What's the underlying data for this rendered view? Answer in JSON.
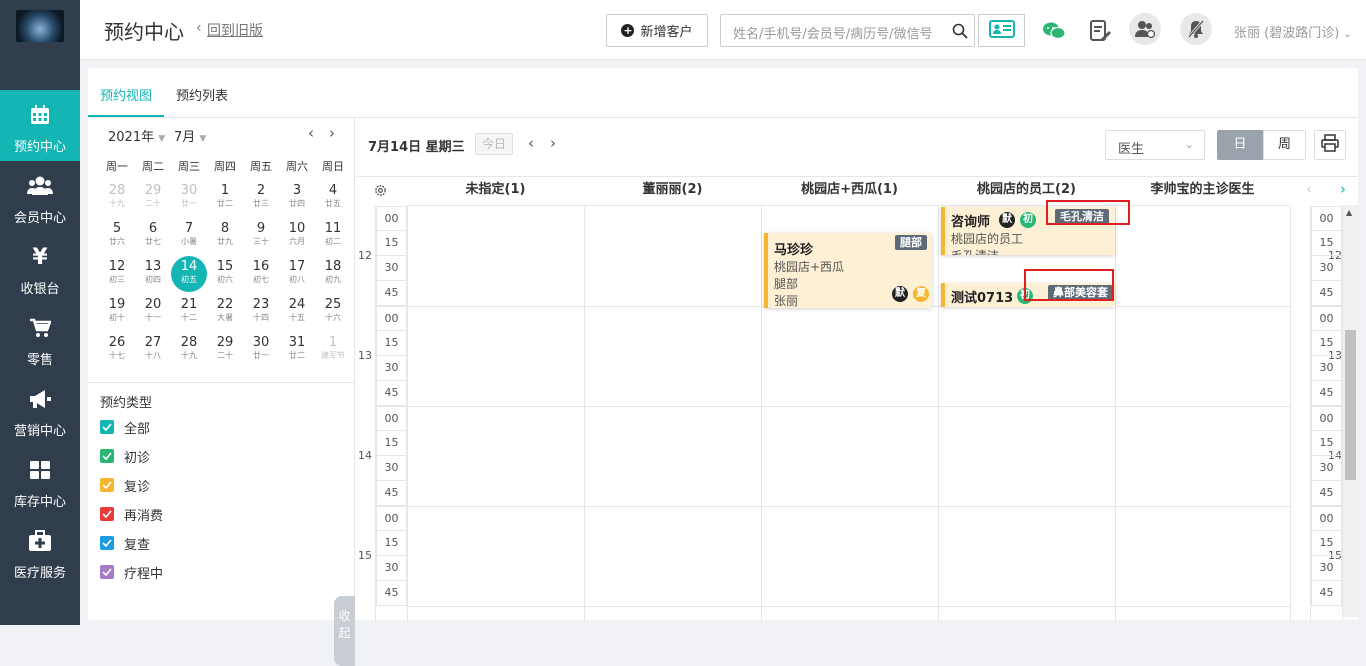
{
  "sidebar": {
    "items": [
      {
        "label": "预约中心",
        "icon": "calendar-icon",
        "active": true
      },
      {
        "label": "会员中心",
        "icon": "users-icon"
      },
      {
        "label": "收银台",
        "icon": "yen-icon"
      },
      {
        "label": "零售",
        "icon": "cart-icon"
      },
      {
        "label": "营销中心",
        "icon": "megaphone-icon"
      },
      {
        "label": "库存中心",
        "icon": "grid-icon"
      },
      {
        "label": "医疗服务",
        "icon": "medkit-icon"
      }
    ]
  },
  "topbar": {
    "title": "预约中心",
    "back_link": "回到旧版",
    "new_customer": "新增客户",
    "search_placeholder": "姓名/手机号/会员号/病历号/微信号",
    "user": "张丽 (碧波路门诊)"
  },
  "tabs": [
    "预约视图",
    "预约列表"
  ],
  "calendar": {
    "year": "2021年",
    "month": "7月",
    "weekdays": [
      "周一",
      "周二",
      "周三",
      "周四",
      "周五",
      "周六",
      "周日"
    ],
    "days": [
      [
        "28",
        "十九",
        1
      ],
      [
        "29",
        "二十",
        1
      ],
      [
        "30",
        "廿一",
        1
      ],
      [
        "1",
        "廿二",
        0
      ],
      [
        "2",
        "廿三",
        0
      ],
      [
        "3",
        "廿四",
        0
      ],
      [
        "4",
        "廿五",
        0
      ],
      [
        "5",
        "廿六",
        0
      ],
      [
        "6",
        "廿七",
        0
      ],
      [
        "7",
        "小暑",
        0
      ],
      [
        "8",
        "廿九",
        0
      ],
      [
        "9",
        "三十",
        0
      ],
      [
        "10",
        "六月",
        0
      ],
      [
        "11",
        "初二",
        0
      ],
      [
        "12",
        "初三",
        0
      ],
      [
        "13",
        "初四",
        0
      ],
      [
        "14",
        "初五",
        2
      ],
      [
        "15",
        "初六",
        0
      ],
      [
        "16",
        "初七",
        0
      ],
      [
        "17",
        "初八",
        0
      ],
      [
        "18",
        "初九",
        0
      ],
      [
        "19",
        "初十",
        0
      ],
      [
        "20",
        "十一",
        0
      ],
      [
        "21",
        "十二",
        0
      ],
      [
        "22",
        "大暑",
        0
      ],
      [
        "23",
        "十四",
        0
      ],
      [
        "24",
        "十五",
        0
      ],
      [
        "25",
        "十六",
        0
      ],
      [
        "26",
        "十七",
        0
      ],
      [
        "27",
        "十八",
        0
      ],
      [
        "28",
        "十九",
        0
      ],
      [
        "29",
        "二十",
        0
      ],
      [
        "30",
        "廿一",
        0
      ],
      [
        "31",
        "廿二",
        0
      ],
      [
        "1",
        "建军节",
        1
      ]
    ]
  },
  "types": {
    "title": "预约类型",
    "items": [
      {
        "label": "全部",
        "color": "#14b6b3"
      },
      {
        "label": "初诊",
        "color": "#2bb673"
      },
      {
        "label": "复诊",
        "color": "#f5b731"
      },
      {
        "label": "再消费",
        "color": "#e83c3c"
      },
      {
        "label": "复查",
        "color": "#1e9ae0"
      },
      {
        "label": "疗程中",
        "color": "#a87bc6"
      }
    ]
  },
  "collapse": "收起",
  "toolbar": {
    "date": "7月14日 星期三",
    "today": "今日",
    "filter": "医生",
    "day": "日",
    "week": "周"
  },
  "columns": [
    "未指定(1)",
    "董丽丽(2)",
    "桃园店+西瓜(1)",
    "桃园店的员工(2)",
    "李帅宝的主诊医生"
  ],
  "hours": [
    "12",
    "13",
    "14",
    "15"
  ],
  "minutes": [
    "00",
    "15",
    "30",
    "45"
  ],
  "appointments": [
    {
      "name": "马珍珍",
      "tag": "腿部",
      "lines": [
        "桃园店+西瓜",
        "腿部",
        "张丽"
      ],
      "badges": [
        {
          "t": "默",
          "c": "#222"
        },
        {
          "t": "复",
          "c": "#f5b731"
        }
      ]
    },
    {
      "name": "咨询师",
      "tag": "毛孔清洁",
      "lines": [
        "桃园店的员工",
        "毛孔清洁"
      ],
      "badges": [
        {
          "t": "默",
          "c": "#222"
        },
        {
          "t": "初",
          "c": "#2bb673"
        }
      ]
    },
    {
      "name": "测试0713",
      "tag": "鼻部美容套",
      "lines": [],
      "badges": [
        {
          "t": "初",
          "c": "#2bb673"
        }
      ]
    }
  ]
}
